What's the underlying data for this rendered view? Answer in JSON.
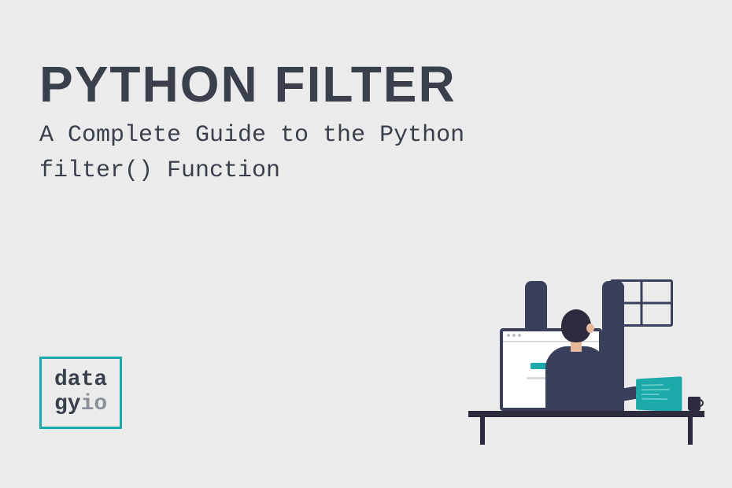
{
  "header": {
    "title": "PYTHON FILTER",
    "subtitle": "A Complete Guide to the Python filter() Function"
  },
  "logo": {
    "line1": "data",
    "line2_left": "gy",
    "line2_right": "io"
  },
  "colors": {
    "background": "#ebebeb",
    "text": "#3a3f4c",
    "accent": "#1ba9a9",
    "muted": "#8a8f99",
    "dark": "#2c2c3e",
    "navy": "#3a3f5c"
  }
}
